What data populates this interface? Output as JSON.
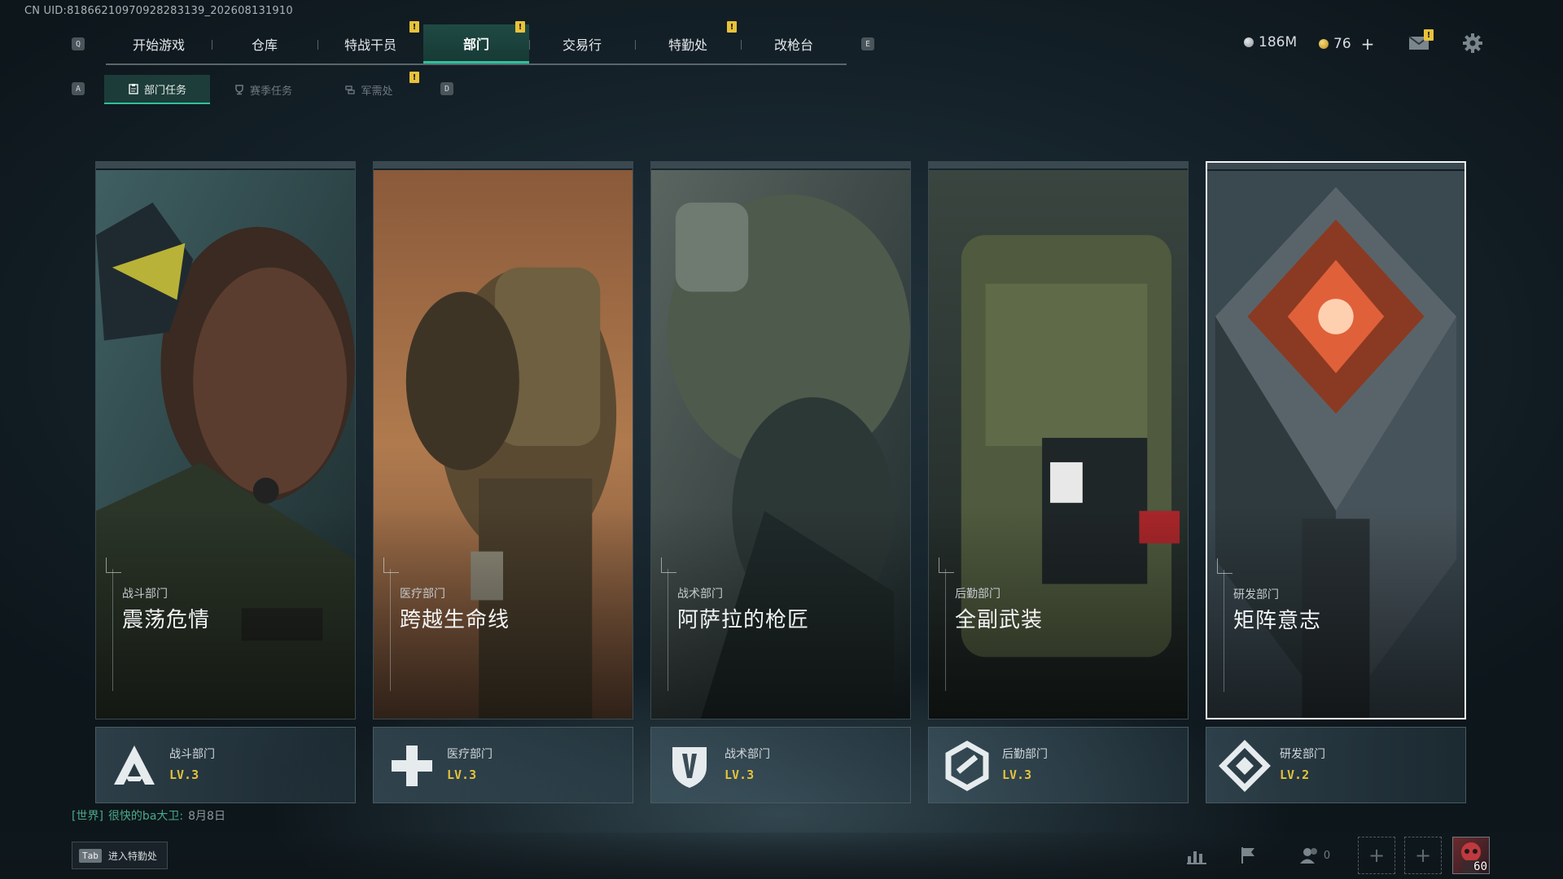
{
  "uid_text": "CN UID:81866210970928283139_202608131910",
  "keycaps": {
    "prev_main": "Q",
    "next_main": "E",
    "prev_sub": "A",
    "next_sub": "D"
  },
  "main_tabs": [
    {
      "label": "开始游戏",
      "badge": ""
    },
    {
      "label": "仓库",
      "badge": ""
    },
    {
      "label": "特战干员",
      "badge": "!"
    },
    {
      "label": "部门",
      "badge": "!",
      "active": true
    },
    {
      "label": "交易行",
      "badge": ""
    },
    {
      "label": "特勤处",
      "badge": "!"
    },
    {
      "label": "改枪台",
      "badge": ""
    }
  ],
  "sub_tabs": [
    {
      "label": "部门任务",
      "active": true
    },
    {
      "label": "赛季任务"
    },
    {
      "label": "军需处",
      "badge": "!"
    }
  ],
  "currency": {
    "silver": "186M",
    "gold": "76",
    "plus": "+"
  },
  "mail_badge": "!",
  "cards": [
    {
      "dept": "战斗部门",
      "title": "震荡危情",
      "level": "LV.3",
      "icon": "combat-icon"
    },
    {
      "dept": "医疗部门",
      "title": "跨越生命线",
      "level": "LV.3",
      "icon": "medical-icon"
    },
    {
      "dept": "战术部门",
      "title": "阿萨拉的枪匠",
      "level": "LV.3",
      "icon": "tactical-icon"
    },
    {
      "dept": "后勤部门",
      "title": "全副武装",
      "level": "LV.3",
      "icon": "logistics-icon"
    },
    {
      "dept": "研发部门",
      "title": "矩阵意志",
      "level": "LV.2",
      "icon": "research-icon"
    }
  ],
  "chat": {
    "channel": "[世界]",
    "user": "很快的ba大卫:",
    "message": "8月8日"
  },
  "bottom": {
    "tab_key": "Tab",
    "tab_label": "进入特勤处",
    "friends_count": "0",
    "player_level": "60"
  },
  "colors": {
    "accent": "#2fbf9c",
    "badge": "#e8c23a",
    "level": "#e3c23d"
  }
}
